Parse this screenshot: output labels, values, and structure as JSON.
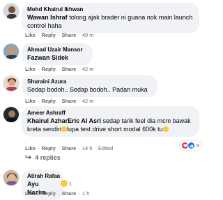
{
  "comments": [
    {
      "author": "Mohd Khairul Ikhwan",
      "tag": "Wawan Ishraf",
      "text": " tolong ajak brader ni guana nok main launch control haha",
      "like": "Like",
      "reply": "Reply",
      "share": "Share",
      "time": "40 m"
    },
    {
      "author": "Ahmad Uzair Mansor",
      "tag": "Fazwan Sidek",
      "text": "",
      "like": "Like",
      "reply": "Reply",
      "share": "Share",
      "time": "42 m"
    },
    {
      "author": "Shuraini Azura",
      "tag": "",
      "text": "Sedap bodoh.. Sedap bodoh.. Padan muka",
      "like": "Like",
      "reply": "Reply",
      "share": "Share",
      "time": "42 m"
    },
    {
      "author": "Ameer Ashraff",
      "tag": "Khairul AzharEric Al Asri",
      "text_part1": " sedap tarik feel dia mcm bawak kreta sendiri",
      "text_part2": "lupa test drive short modal 600k tu",
      "like": "Like",
      "reply": "Reply",
      "share": "Share",
      "time": "14 h",
      "edited": "Edited",
      "reaction_count": "6"
    },
    {
      "author": "Atirah Rafaa",
      "tag": "Ayu Nazira",
      "text": "",
      "like": "Like",
      "reply": "Reply",
      "share": "Share",
      "time": "1 h",
      "reaction_count": "1"
    }
  ],
  "replies_link": "4 replies",
  "colors": {
    "bubble": "#f0f2f5",
    "meta": "#65676b",
    "heart": "#f02849",
    "like": "#1877f2",
    "emoji": "#f7c93b"
  }
}
